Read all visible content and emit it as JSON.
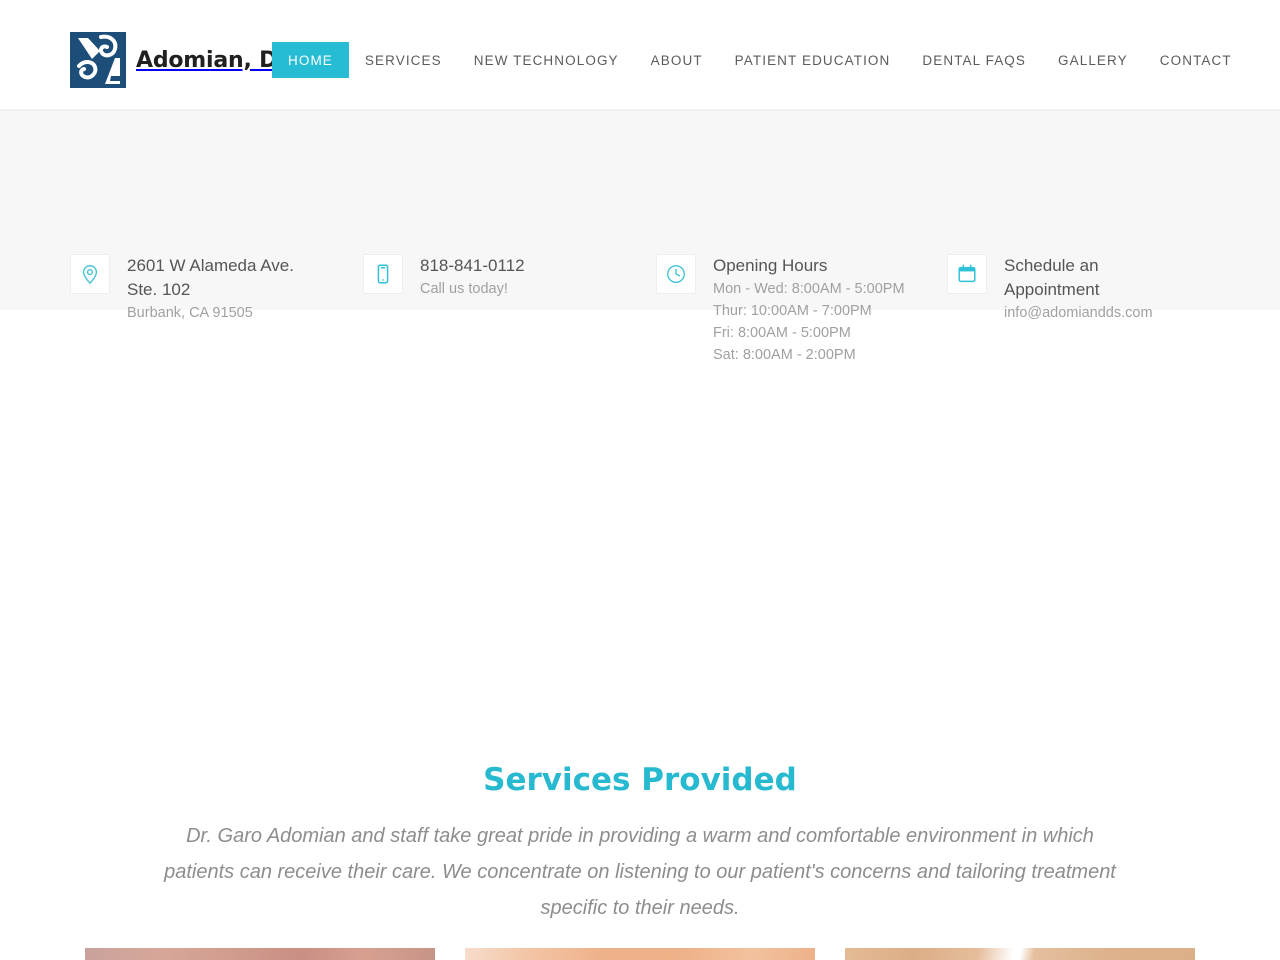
{
  "header": {
    "brand_name": "Adomian, DDS",
    "logo_icon": "dental-monogram-logo",
    "nav": [
      {
        "label": "HOME",
        "active": true
      },
      {
        "label": "SERVICES",
        "active": false
      },
      {
        "label": "NEW TECHNOLOGY",
        "active": false
      },
      {
        "label": "ABOUT",
        "active": false
      },
      {
        "label": "PATIENT EDUCATION",
        "active": false
      },
      {
        "label": "DENTAL FAQS",
        "active": false
      },
      {
        "label": "GALLERY",
        "active": false
      },
      {
        "label": "CONTACT",
        "active": false
      }
    ]
  },
  "info_bar": {
    "address": {
      "icon": "map-pin-icon",
      "line1": "2601 W Alameda Ave.",
      "line2": "Ste. 102",
      "line3": "Burbank, CA 91505"
    },
    "phone": {
      "icon": "mobile-phone-icon",
      "number": "818-841-0112",
      "caption": "Call us today!"
    },
    "hours": {
      "icon": "clock-icon",
      "title": "Opening Hours",
      "lines": [
        "Mon - Wed: 8:00AM - 5:00PM",
        "Thur: 10:00AM - 7:00PM",
        "Fri: 8:00AM - 5:00PM",
        "Sat: 8:00AM - 2:00PM"
      ]
    },
    "appointment": {
      "icon": "calendar-icon",
      "title_line1": "Schedule an",
      "title_line2": "Appointment",
      "email": "info@adomiandds.com"
    }
  },
  "services": {
    "title": "Services Provided",
    "intro": "Dr. Garo Adomian and staff take great pride in providing a warm and comfortable environment in which patients can receive their care. We concentrate on listening to our patient's concerns and tailoring treatment specific to their needs.",
    "cards": [
      {
        "name": "service-card-1",
        "image": "dental-photo-mauve"
      },
      {
        "name": "service-card-2",
        "image": "dental-photo-peach"
      },
      {
        "name": "service-card-3",
        "image": "dental-photo-tan-split"
      }
    ]
  },
  "colors": {
    "accent": "#25bcd4",
    "heading": "#27b9d0",
    "logo_navy": "#1d4e79",
    "info_bar_bg": "#f7f7f7",
    "body_text": "#8d8d8d",
    "nav_text": "#5b5b5b"
  }
}
